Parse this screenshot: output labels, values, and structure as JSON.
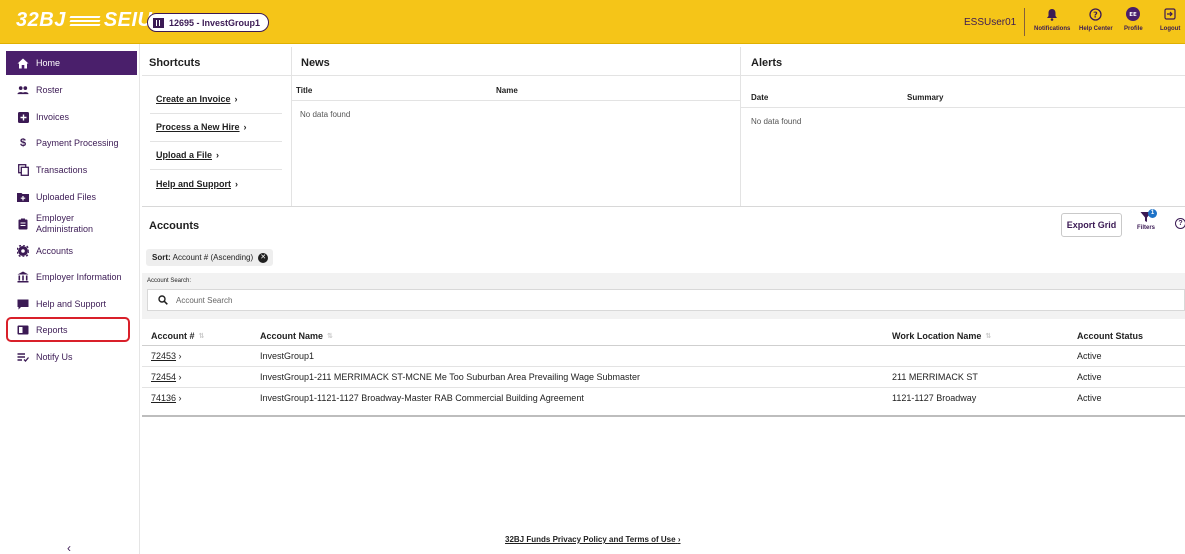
{
  "header": {
    "logo_left": "32BJ",
    "logo_right": "SEIU",
    "group": "12695 - InvestGroup1",
    "user": "ESSUser01",
    "actions": [
      {
        "label": "Notifications",
        "icon": "bell-icon"
      },
      {
        "label": "Help Center",
        "icon": "help-circle-icon"
      },
      {
        "label": "Profile",
        "icon": "profile-avatar-icon",
        "initials": "EE"
      },
      {
        "label": "Logout",
        "icon": "logout-icon"
      }
    ]
  },
  "sidebar": {
    "items": [
      {
        "label": "Home",
        "icon": "home-icon"
      },
      {
        "label": "Roster",
        "icon": "people-icon"
      },
      {
        "label": "Invoices",
        "icon": "invoice-plus-icon"
      },
      {
        "label": "Payment Processing",
        "icon": "dollar-icon"
      },
      {
        "label": "Transactions",
        "icon": "copy-icon"
      },
      {
        "label": "Uploaded Files",
        "icon": "folder-plus-icon"
      },
      {
        "label": "Employer Administration",
        "icon": "clipboard-icon"
      },
      {
        "label": "Accounts",
        "icon": "gear-badge-icon"
      },
      {
        "label": "Employer Information",
        "icon": "bank-icon"
      },
      {
        "label": "Help and Support",
        "icon": "chat-icon"
      },
      {
        "label": "Reports",
        "icon": "reports-icon"
      },
      {
        "label": "Notify Us",
        "icon": "notify-icon"
      }
    ],
    "collapse": "‹"
  },
  "shortcuts": {
    "title": "Shortcuts",
    "items": [
      "Create an Invoice",
      "Process a New Hire",
      "Upload a File",
      "Help and Support"
    ]
  },
  "news": {
    "title": "News",
    "col_title": "Title",
    "col_name": "Name",
    "empty": "No data found"
  },
  "alerts": {
    "title": "Alerts",
    "col_date": "Date",
    "col_summary": "Summary",
    "empty": "No data found"
  },
  "accounts": {
    "title": "Accounts",
    "export_label": "Export Grid",
    "filters_label": "Filters",
    "filters_count": "1",
    "help": "?",
    "sort_label": "Sort:",
    "sort_value": "Account # (Ascending)",
    "search_label": "Account Search:",
    "search_placeholder": "Account Search",
    "columns": [
      "Account #",
      "Account Name",
      "Work Location Name",
      "Account Status"
    ],
    "rows": [
      {
        "number": "72453",
        "name": "InvestGroup1",
        "location": "",
        "status": "Active"
      },
      {
        "number": "72454",
        "name": "InvestGroup1-211 MERRIMACK ST-MCNE Me Too Suburban Area Prevailing Wage Submaster",
        "location": "211 MERRIMACK ST",
        "status": "Active"
      },
      {
        "number": "74136",
        "name": "InvestGroup1-1121-1127 Broadway-Master RAB Commercial Building Agreement",
        "location": "1121-1127 Broadway",
        "status": "Active"
      }
    ]
  },
  "footer": {
    "link": "32BJ Funds Privacy Policy and Terms of Use"
  },
  "colors": {
    "brand_yellow": "#f5c518",
    "brand_purple": "#4a1f6b",
    "highlight_red": "#d9202a"
  }
}
